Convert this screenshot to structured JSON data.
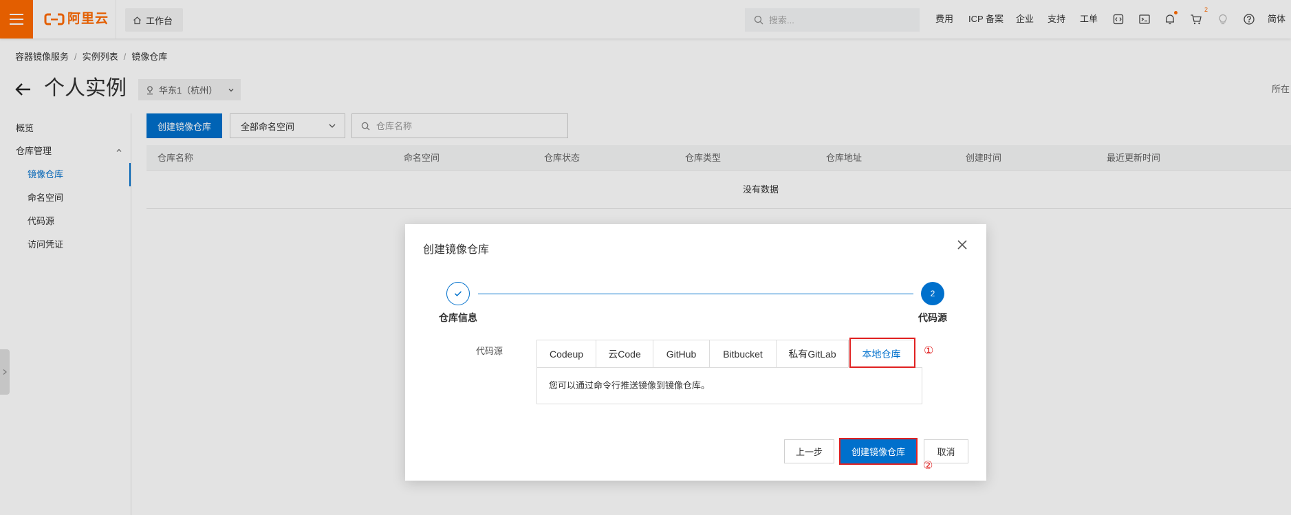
{
  "topbar": {
    "brand": "阿里云",
    "workbench": "工作台",
    "search_placeholder": "搜索...",
    "menu": [
      "费用",
      "ICP 备案",
      "企业",
      "支持",
      "工单"
    ],
    "icons": [
      "code-icon",
      "terminal-icon",
      "bell-icon",
      "cart-icon",
      "lightbulb-icon",
      "help-icon"
    ],
    "cart_badge": "2",
    "language": "简体"
  },
  "breadcrumb": {
    "items": [
      "容器镜像服务",
      "实例列表",
      "镜像仓库"
    ],
    "separator": "/"
  },
  "page": {
    "title": "个人实例",
    "region": "华东1（杭州）",
    "right_label": "所在"
  },
  "sidebar": {
    "overview": "概览",
    "group": "仓库管理",
    "items": [
      "镜像仓库",
      "命名空间",
      "代码源",
      "访问凭证"
    ],
    "active": "镜像仓库"
  },
  "toolbar": {
    "create_button": "创建镜像仓库",
    "namespace_filter": "全部命名空间",
    "search_placeholder": "仓库名称"
  },
  "table": {
    "columns": [
      "仓库名称",
      "命名空间",
      "仓库状态",
      "仓库类型",
      "仓库地址",
      "创建时间",
      "最近更新时间"
    ],
    "empty_text": "没有数据"
  },
  "dialog": {
    "title": "创建镜像仓库",
    "steps": [
      {
        "label": "仓库信息",
        "status": "done"
      },
      {
        "label": "代码源",
        "number": "2",
        "status": "current"
      }
    ],
    "source_label": "代码源",
    "tabs": [
      "Codeup",
      "云Code",
      "GitHub",
      "Bitbucket",
      "私有GitLab",
      "本地仓库"
    ],
    "active_tab": "本地仓库",
    "tab_content": "您可以通过命令行推送镜像到镜像仓库。",
    "buttons": {
      "prev": "上一步",
      "create": "创建镜像仓库",
      "cancel": "取消"
    },
    "annotations": [
      "①",
      "②"
    ]
  },
  "colors": {
    "brand": "#ff6a00",
    "primary": "#0070cc",
    "annotation": "#e02020"
  }
}
